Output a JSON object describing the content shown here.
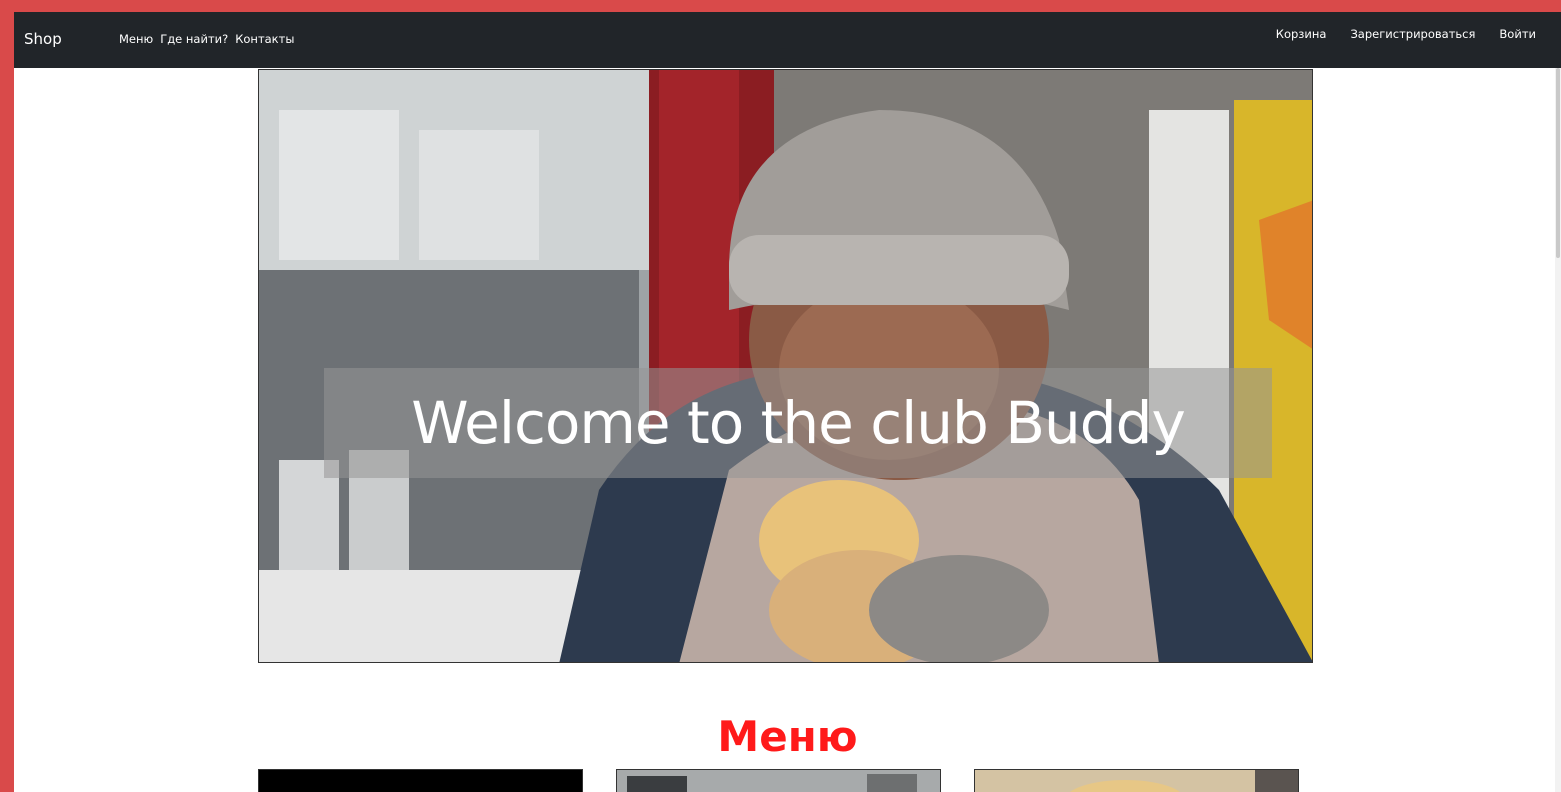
{
  "navbar": {
    "brand": "Shop",
    "left_links": [
      "Меню",
      "Где найти?",
      "Контакты"
    ],
    "right_links": [
      "Корзина",
      "Зарегистрироваться",
      "Войти"
    ]
  },
  "hero": {
    "caption": "Welcome to the club Buddy"
  },
  "menu_section": {
    "title": "Меню"
  },
  "colors": {
    "page_border": "#d94a4a",
    "navbar_bg": "#212529",
    "title_color": "#ff1a1a"
  }
}
